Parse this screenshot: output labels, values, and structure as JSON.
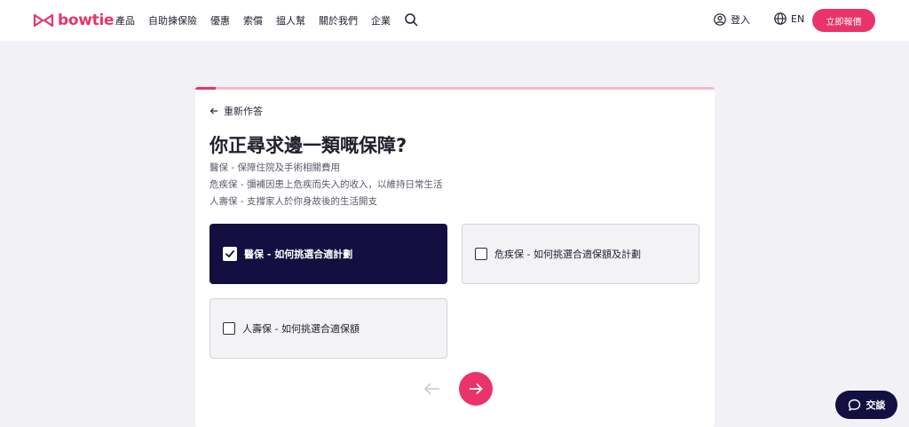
{
  "brand": {
    "name": "bowtie",
    "color": "#e9336a"
  },
  "nav": {
    "items": [
      "產品",
      "自助揀保險",
      "優惠",
      "索償",
      "搵人幫",
      "關於我們",
      "企業"
    ],
    "search_icon": "search-icon"
  },
  "header": {
    "login_label": "登入",
    "lang_label": "EN",
    "quote_label": "立即報價"
  },
  "quiz": {
    "progress_fraction": 0.04,
    "back_label": "重新作答",
    "title": "你正尋求邊一類嘅保障?",
    "descriptions": [
      "醫保 - 保障住院及手術相關費用",
      "危疾保 - 彌補因患上危疾而失入的收入，以維持日常生活",
      "人壽保 - 支撐家人於你身故後的生活開支"
    ],
    "options": [
      {
        "label": "醫保 - 如何挑選合適計劃",
        "selected": true
      },
      {
        "label": "危疾保 - 如何挑選合適保額及計劃",
        "selected": false
      },
      {
        "label": "人壽保 - 如何挑選合適保額",
        "selected": false
      }
    ]
  },
  "chat": {
    "label": "交談"
  },
  "colors": {
    "accent": "#e9336a",
    "navy": "#130f40",
    "page_bg": "#f2f2f6"
  }
}
